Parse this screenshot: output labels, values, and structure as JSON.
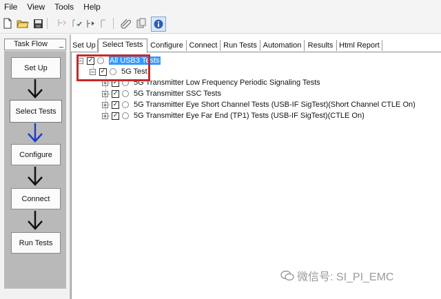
{
  "menu": [
    "File",
    "View",
    "Tools",
    "Help"
  ],
  "toolbar": {
    "icons": [
      "new-file-icon",
      "open-folder-icon",
      "save-icon",
      "select-tool-icon",
      "step-icon",
      "run-to-icon",
      "filter-icon",
      "copy-icon",
      "paste-icon",
      "info-icon"
    ]
  },
  "task_flow": {
    "title": "Task Flow",
    "min_label": "_",
    "steps": [
      {
        "label": "Set Up",
        "active": false
      },
      {
        "label": "Select Tests",
        "active": true
      },
      {
        "label": "Configure",
        "active": false
      },
      {
        "label": "Connect",
        "active": false
      },
      {
        "label": "Run Tests",
        "active": false
      }
    ],
    "arrow_color": "#111111",
    "active_arrow_color": "#1c3ccc"
  },
  "tabs": [
    {
      "label": "Set Up",
      "active": false
    },
    {
      "label": "Select Tests",
      "active": true
    },
    {
      "label": "Configure",
      "active": false
    },
    {
      "label": "Connect",
      "active": false
    },
    {
      "label": "Run Tests",
      "active": false
    },
    {
      "label": "Automation",
      "active": false
    },
    {
      "label": "Results",
      "active": false
    },
    {
      "label": "Html Report",
      "active": false
    }
  ],
  "tree": {
    "root": {
      "label": "All USB3 Tests",
      "expand": "−",
      "checked": true,
      "selected": true
    },
    "group": {
      "label": "5G Test",
      "expand": "−",
      "checked": true
    },
    "children": [
      {
        "label": "5G Transmitter Low Frequency Periodic Signaling Tests",
        "expand": "+",
        "checked": true
      },
      {
        "label": "5G Transmitter SSC Tests",
        "expand": "+",
        "checked": true
      },
      {
        "label": "5G Transmitter Eye Short Channel Tests (USB-IF SigTest)(Short Channel CTLE On)",
        "expand": "+",
        "checked": true
      },
      {
        "label": "5G Transmitter Eye Far End (TP1) Tests (USB-IF SigTest)(CTLE On)",
        "expand": "+",
        "checked": true
      }
    ],
    "check_mark": "✓"
  },
  "watermark": {
    "text": "微信号: SI_PI_EMC"
  },
  "colors": {
    "highlight": "#c62828",
    "selection": "#3399ff"
  }
}
